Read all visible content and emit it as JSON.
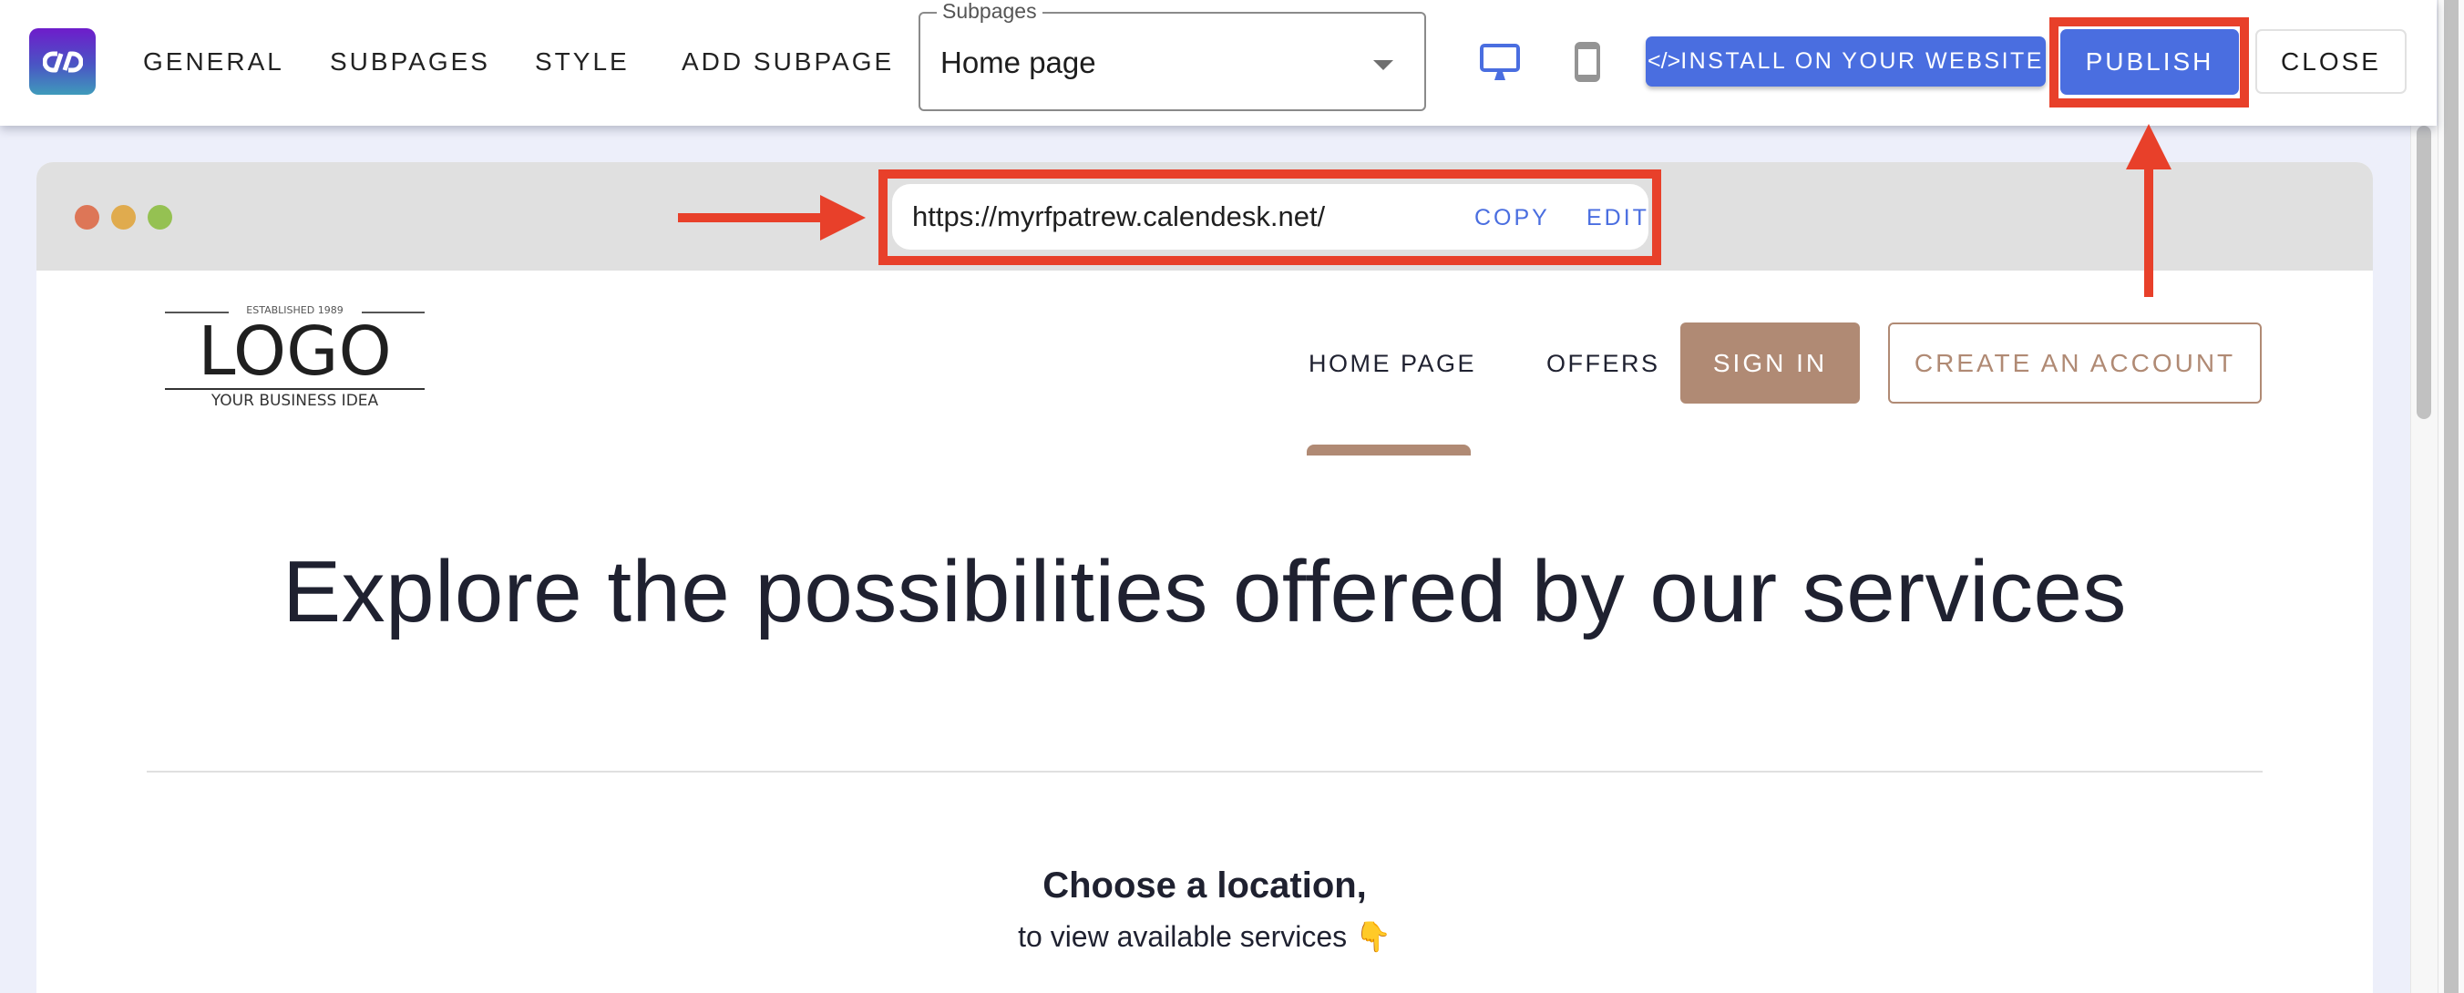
{
  "header": {
    "logo_icon": "link-icon",
    "tabs": [
      {
        "label": "GENERAL"
      },
      {
        "label": "SUBPAGES"
      },
      {
        "label": "STYLE"
      },
      {
        "label": "ADD SUBPAGE"
      }
    ],
    "subpage_select": {
      "label": "Subpages",
      "value": "Home page"
    },
    "device_toggle": {
      "desktop_icon": "desktop-icon",
      "mobile_icon": "mobile-icon",
      "active": "desktop"
    },
    "install_button": {
      "icon": "code-icon",
      "icon_glyph": "</>",
      "label": "INSTALL ON YOUR WEBSITE"
    },
    "publish_button": {
      "label": "PUBLISH"
    },
    "close_button": {
      "label": "CLOSE"
    }
  },
  "preview": {
    "window_dots": [
      "#dd7657",
      "#e0ab4e",
      "#95c152"
    ],
    "url": "https://myrfpatrew.calendesk.net/",
    "copy_label": "COPY",
    "edit_label": "EDIT"
  },
  "site": {
    "logo": {
      "established": "ESTABLISHED 1989",
      "name": "LOGO",
      "tagline": "YOUR BUSINESS IDEA"
    },
    "nav": [
      {
        "label": "HOME PAGE",
        "active": true
      },
      {
        "label": "OFFERS",
        "active": false
      }
    ],
    "sign_in_label": "SIGN IN",
    "create_account_label": "CREATE AN ACCOUNT",
    "hero_title": "Explore the possibilities offered by our services",
    "location_title": "Choose a location,",
    "location_subtitle": "to view available services 👇"
  },
  "colors": {
    "primary": "#4a6ee0",
    "site_accent": "#b08a74",
    "annotation_red": "#e8402a",
    "text_dark": "#1f2130"
  }
}
